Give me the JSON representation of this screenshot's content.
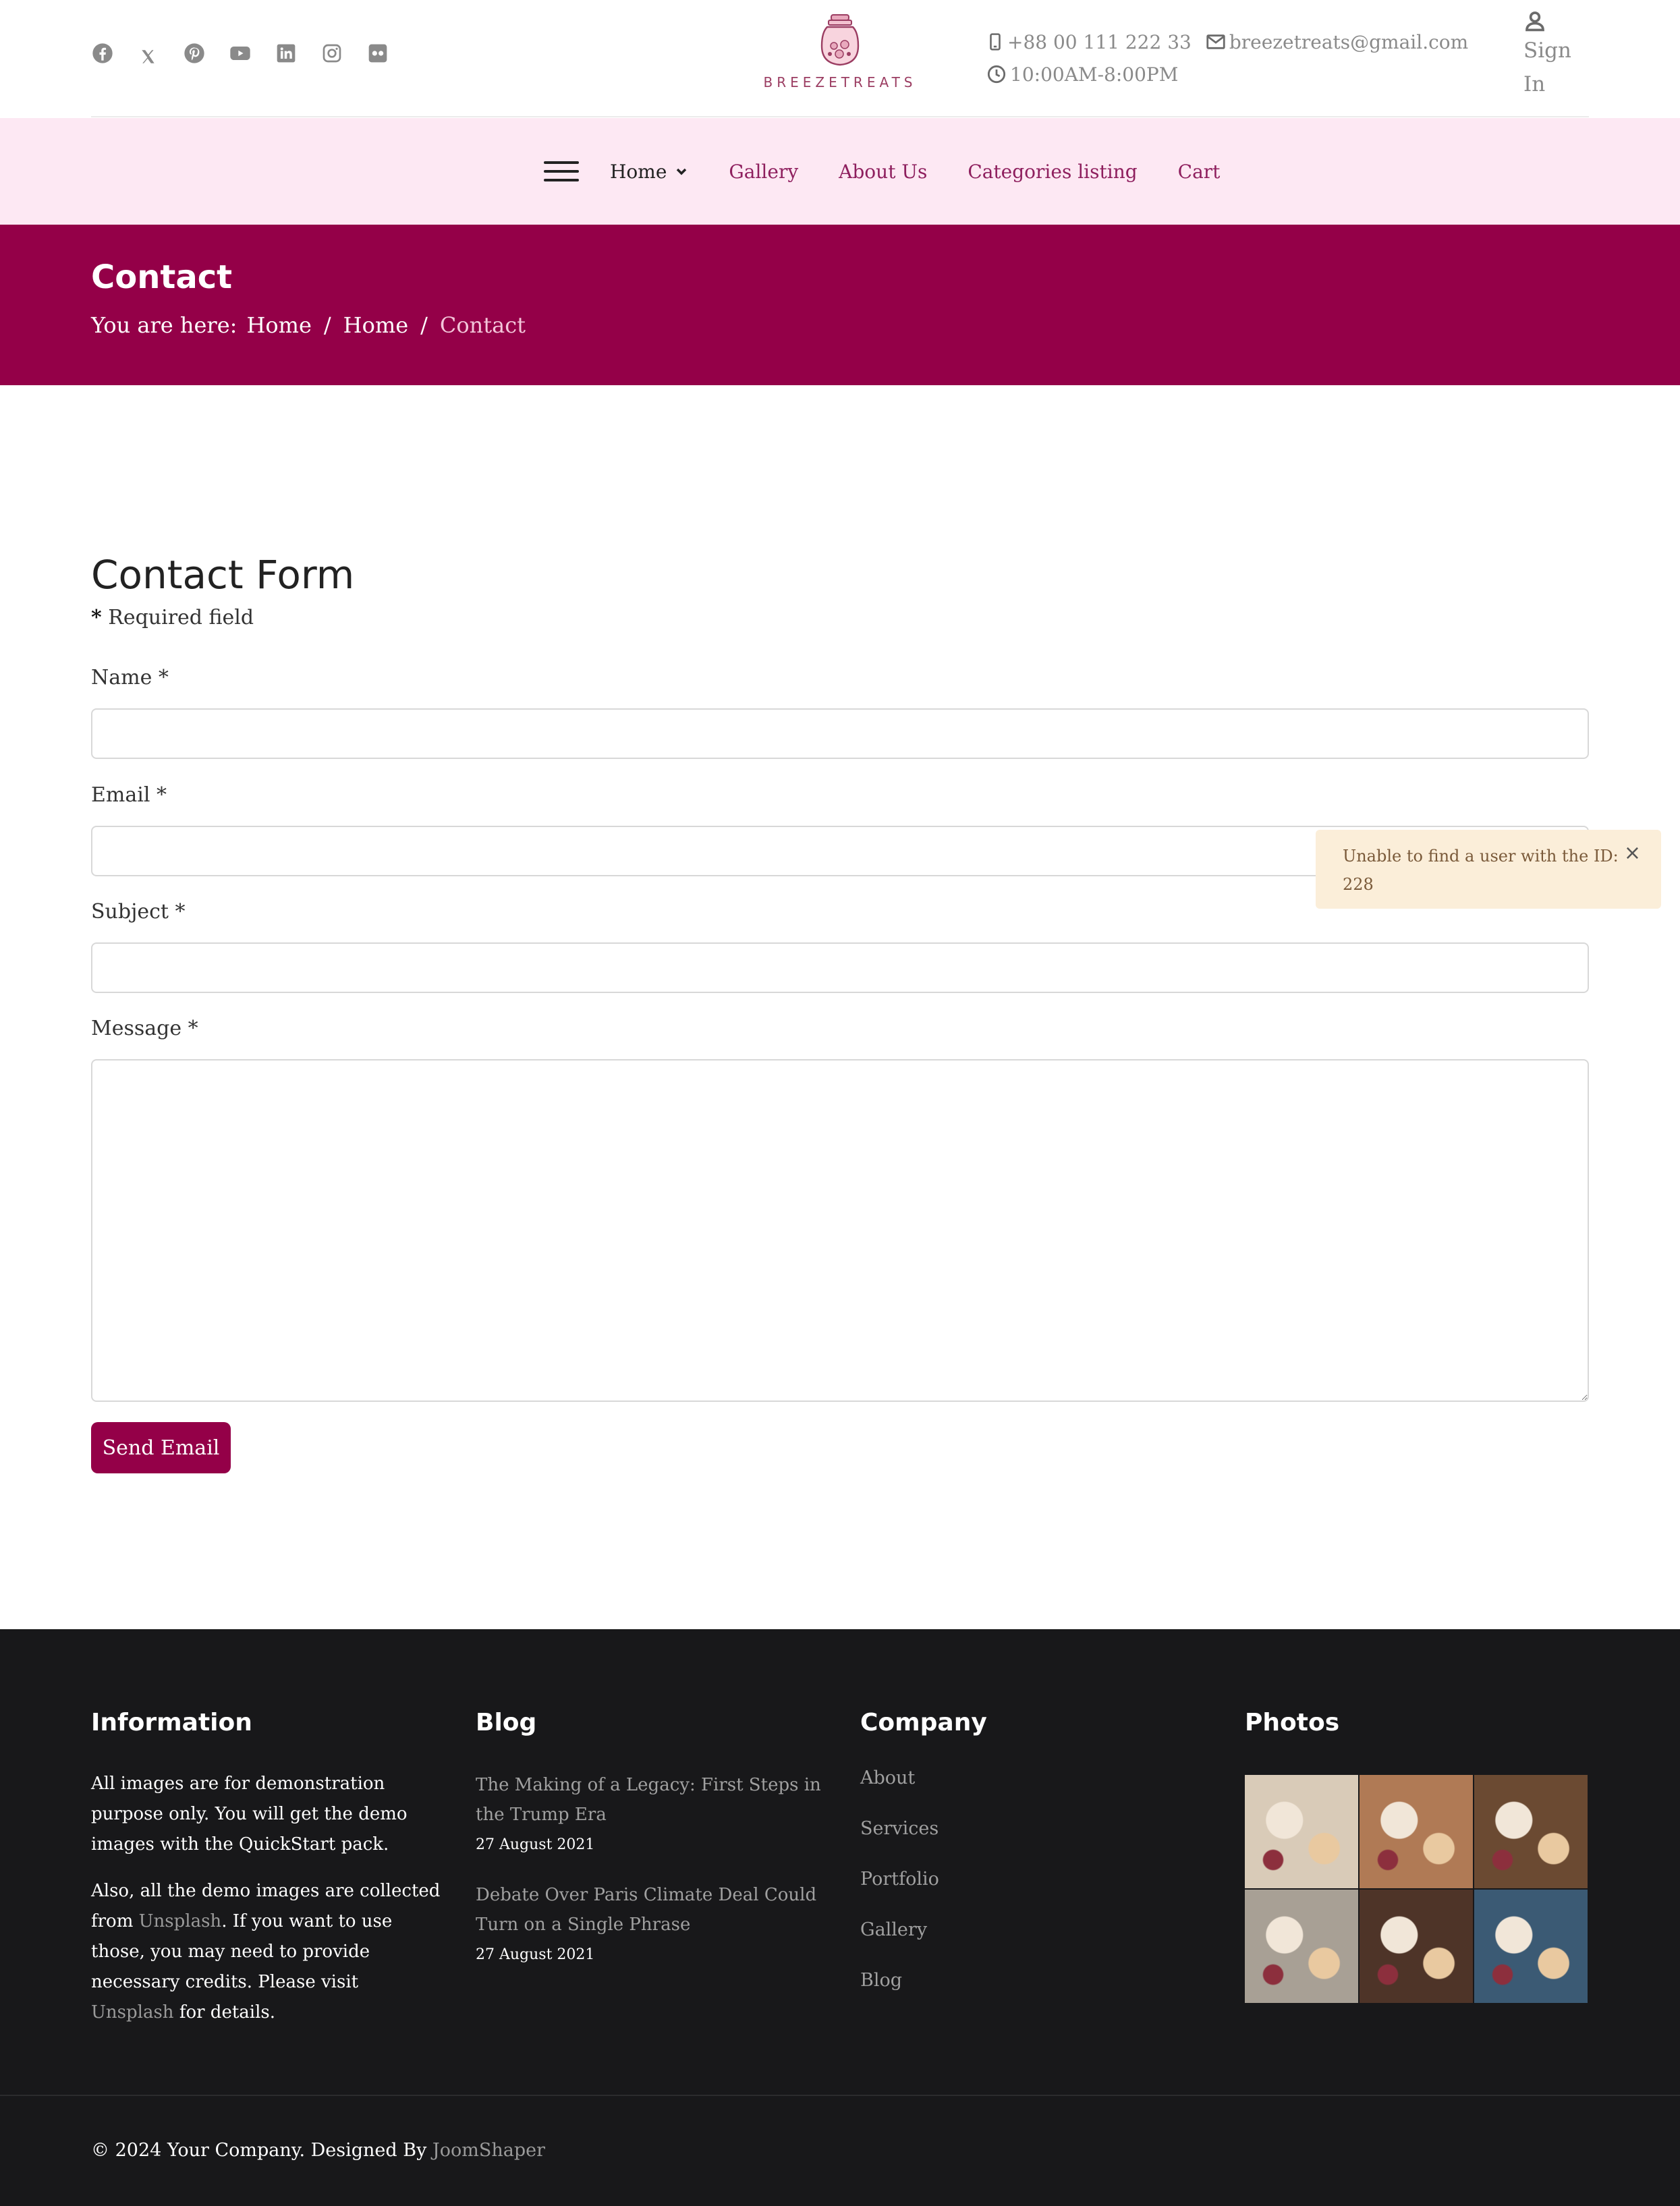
{
  "header": {
    "social_icons": [
      "facebook-icon",
      "x-icon",
      "pinterest-icon",
      "youtube-icon",
      "linkedin-icon",
      "instagram-icon",
      "flickr-icon"
    ],
    "logo_text": "BREEZETREATS",
    "phone": "+88 00 111 222 33",
    "email": "breezetreats@gmail.com",
    "hours": "10:00AM-8:00PM",
    "signin_line1": "Sign",
    "signin_line2": "In"
  },
  "nav": {
    "items": [
      {
        "label": "Home"
      },
      {
        "label": "Gallery"
      },
      {
        "label": "About Us"
      },
      {
        "label": "Categories listing"
      },
      {
        "label": "Cart"
      }
    ]
  },
  "page": {
    "title": "Contact",
    "breadcrumb_prefix": "You are here:",
    "breadcrumb": [
      "Home",
      "Home",
      "Contact"
    ],
    "separator": "/"
  },
  "form": {
    "heading": "Contact Form",
    "required_star": "*",
    "required_text": "Required field",
    "name_label": "Name *",
    "email_label": "Email *",
    "subject_label": "Subject *",
    "message_label": "Message *",
    "name_value": "",
    "email_value": "",
    "subject_value": "",
    "message_value": "",
    "submit_label": "Send Email"
  },
  "toast": {
    "message": "Unable to find a user with the ID: 228",
    "close_glyph": "×"
  },
  "footer": {
    "info": {
      "heading": "Information",
      "p1": "All images are for demonstration purpose only. You will get the demo images with the QuickStart pack.",
      "p2_a": "Also, all the demo images are collected from ",
      "p2_link1": "Unsplash",
      "p2_b": ". If you want to use those, you may need to provide necessary credits. Please visit ",
      "p2_link2": "Unsplash",
      "p2_c": " for details."
    },
    "blog": {
      "heading": "Blog",
      "posts": [
        {
          "title": "The Making of a Legacy: First Steps in the Trump Era",
          "date": "27 August 2021"
        },
        {
          "title": "Debate Over Paris Climate Deal Could Turn on a Single Phrase",
          "date": "27 August 2021"
        }
      ]
    },
    "company": {
      "heading": "Company",
      "links": [
        "About",
        "Services",
        "Portfolio",
        "Gallery",
        "Blog"
      ]
    },
    "photos": {
      "heading": "Photos",
      "colors": [
        "#d9cbb8",
        "#b07a55",
        "#6b4a32",
        "#a8a095",
        "#4e3428",
        "#3b5a74"
      ]
    },
    "copyright_text": "© 2024 Your Company. Designed By ",
    "copyright_link": "JoomShaper"
  }
}
